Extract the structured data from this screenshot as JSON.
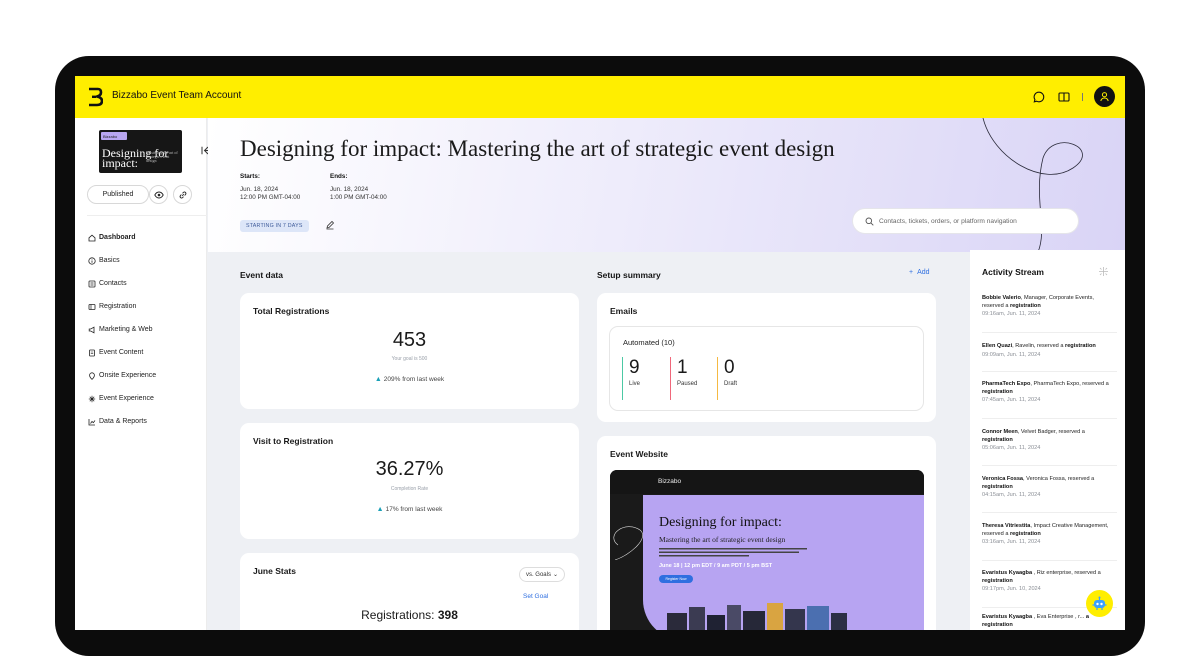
{
  "topbar": {
    "account_name": "Bizzabo Event Team Account",
    "icons": [
      "chat-icon",
      "book-icon",
      "user-icon"
    ]
  },
  "sidebar": {
    "thumb_tag": "Bizzabo",
    "thumb_title": "Designing for impact:",
    "thumb_sub": "Mastering the art of strategic event design",
    "status_button": "Published",
    "items": [
      {
        "label": "Dashboard",
        "icon": "home-icon"
      },
      {
        "label": "Basics",
        "icon": "info-icon"
      },
      {
        "label": "Contacts",
        "icon": "contacts-icon"
      },
      {
        "label": "Registration",
        "icon": "registration-icon"
      },
      {
        "label": "Marketing & Web",
        "icon": "megaphone-icon"
      },
      {
        "label": "Event Content",
        "icon": "content-icon"
      },
      {
        "label": "Onsite Experience",
        "icon": "pin-icon"
      },
      {
        "label": "Event Experience",
        "icon": "sparkle-icon"
      },
      {
        "label": "Data & Reports",
        "icon": "chart-icon"
      }
    ]
  },
  "hero": {
    "title": "Designing for impact: Mastering the art of strategic event design",
    "starts_label": "Starts:",
    "starts_date": "Jun. 18, 2024",
    "starts_time": "12:00 PM GMT-04:00",
    "ends_label": "Ends:",
    "ends_date": "Jun. 18, 2024",
    "ends_time": "1:00 PM GMT-04:00",
    "badge": "STARTING IN 7 DAYS",
    "search_placeholder": "Contacts, tickets, orders, or platform navigation"
  },
  "event_data": {
    "section_title": "Event data",
    "total_registrations": {
      "title": "Total Registrations",
      "value": "453",
      "goal": "Your goal is 500",
      "trend": "209% from last week"
    },
    "visit_to_registration": {
      "title": "Visit to Registration",
      "value": "36.27%",
      "sub": "Completion Rate",
      "trend": "17% from last week"
    },
    "june_stats": {
      "title": "June Stats",
      "compare": "vs. Goals",
      "set_goal": "Set Goal",
      "registrations_label": "Registrations:",
      "registrations_value": "398"
    }
  },
  "setup_summary": {
    "section_title": "Setup summary",
    "add_label": "Add",
    "emails": {
      "title": "Emails",
      "automated": "Automated (10)",
      "stats": [
        {
          "value": "9",
          "label": "Live",
          "color": "#4cc9a4"
        },
        {
          "value": "1",
          "label": "Paused",
          "color": "#f0677a"
        },
        {
          "value": "0",
          "label": "Draft",
          "color": "#f5b942"
        }
      ]
    },
    "website": {
      "title": "Event Website",
      "preview_logo": "Bizzabo",
      "preview_title": "Designing for impact:",
      "preview_sub": "Mastering the art of strategic event design",
      "preview_date": "June 18 | 12 pm EDT / 9 am PDT / 5 pm BST",
      "preview_button": "Register Now"
    }
  },
  "activity": {
    "title": "Activity Stream",
    "items": [
      {
        "name": "Bobbie Valerio",
        "detail": ", Manager, Corporate Events, reserved a ",
        "action": "registration",
        "time": "09:16am, Jun. 11, 2024"
      },
      {
        "name": "Ellen Quazi",
        "detail": ", Ravelin, reserved a ",
        "action": "registration",
        "time": "09:09am, Jun. 11, 2024"
      },
      {
        "name": "PharmaTech Expo",
        "detail": ", PharmaTech Expo, reserved a ",
        "action": "registration",
        "time": "07:45am, Jun. 11, 2024"
      },
      {
        "name": "Connor Meen",
        "detail": ", Velvet Badger, reserved a ",
        "action": "registration",
        "time": "05:06am, Jun. 11, 2024"
      },
      {
        "name": "Veronica Fossa",
        "detail": ", Veronica Fossa, reserved a ",
        "action": "registration",
        "time": "04:15am, Jun. 11, 2024"
      },
      {
        "name": "Theresa Vitriestita",
        "detail": ", Impact Creative Management, reserved a ",
        "action": "registration",
        "time": "03:16am, Jun. 11, 2024"
      },
      {
        "name": "Evaristus Kyaagba",
        "detail": " , Riz enterprise, reserved a ",
        "action": "registration",
        "time": "09:17pm, Jun. 10, 2024"
      },
      {
        "name": "Evaristus Kyaagba",
        "detail": " , Eva Enterprise , r... ",
        "action": "a registration",
        "time": ""
      }
    ]
  },
  "colors": {
    "brand_yellow": "#ffee00",
    "accent_blue": "#2f6fe0",
    "hero_lavender": "#d9d4f6",
    "trend_teal": "#1aa0b7"
  }
}
